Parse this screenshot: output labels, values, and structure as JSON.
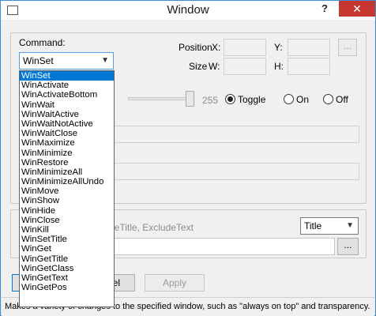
{
  "window": {
    "title": "Window",
    "help": "?",
    "close": "✕"
  },
  "command": {
    "label": "Command:",
    "selected": "WinSet",
    "options": [
      "WinSet",
      "WinActivate",
      "WinActivateBottom",
      "WinWait",
      "WinWaitActive",
      "WinWaitNotActive",
      "WinWaitClose",
      "WinMaximize",
      "WinMinimize",
      "WinRestore",
      "WinMinimizeAll",
      "WinMinimizeAllUndo",
      "WinMove",
      "WinShow",
      "WinHide",
      "WinClose",
      "WinKill",
      "WinSetTitle",
      "WinGet",
      "WinGetTitle",
      "WinGetClass",
      "WinGetText",
      "WinGetPos"
    ]
  },
  "position": {
    "label": "Position",
    "x_label": "X:",
    "y_label": "Y:",
    "browse": "..."
  },
  "size": {
    "label": "Size",
    "w_label": "W:",
    "h_label": "H:"
  },
  "transparency": {
    "value": "255"
  },
  "toggle": {
    "toggle_label": "Toggle",
    "on_label": "On",
    "off_label": "Off"
  },
  "title_group": {
    "hint_partial": "leTitle, ExcludeText",
    "mode_select": "Title",
    "browse": "..."
  },
  "buttons": {
    "ok_partial": "",
    "cancel_partial": "el",
    "apply": "Apply"
  },
  "status": {
    "text": "Makes a variety of changes to the specified window, such as \"always on top\" and transparency."
  }
}
